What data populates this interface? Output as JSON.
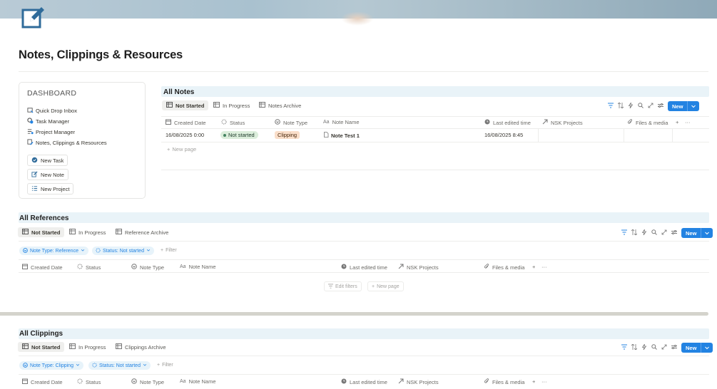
{
  "page": {
    "title": "Notes, Clippings & Resources"
  },
  "dashboard": {
    "title": "DASHBOARD",
    "links": [
      {
        "label": "Quick Drop Inbox",
        "icon": "inbox-icon"
      },
      {
        "label": "Task Manager",
        "icon": "gear-check-icon"
      },
      {
        "label": "Project Manager",
        "icon": "list-icon"
      },
      {
        "label": "Notes, Clippings & Resources",
        "icon": "notes-icon"
      }
    ],
    "buttons": [
      {
        "label": "New Task",
        "icon": "check-circle-icon"
      },
      {
        "label": "New Note",
        "icon": "edit-icon"
      },
      {
        "label": "New Project",
        "icon": "checklist-icon"
      }
    ]
  },
  "all_notes": {
    "title": "All Notes",
    "tabs": [
      "Not Started",
      "In Progress",
      "Notes Archive"
    ],
    "new_label": "New",
    "columns": [
      "Created Date",
      "Status",
      "Note Type",
      "Note Name",
      "Last edited time",
      "NSK Projects",
      "Files & media"
    ],
    "rows": [
      {
        "created": "16/08/2025 0:00",
        "status": "Not started",
        "type": "Clipping",
        "name": "Note Test 1",
        "edited": "16/08/2025 8:45"
      }
    ],
    "new_page": "New page",
    "add_col": "+",
    "more": "···"
  },
  "all_references": {
    "title": "All References",
    "tabs": [
      "Not Started",
      "In Progress",
      "Reference Archive"
    ],
    "new_label": "New",
    "filters": [
      "Note Type: Reference",
      "Status: Not started"
    ],
    "filter_add": "Filter",
    "columns": [
      "Created Date",
      "Status",
      "Note Type",
      "Note Name",
      "Last edited time",
      "NSK Projects",
      "Files & media"
    ],
    "edit_filters": "Edit filters",
    "new_page": "New page",
    "add_col": "+",
    "more": "···"
  },
  "all_clippings": {
    "title": "All Clippings",
    "tabs": [
      "Not Started",
      "In Progress",
      "Clippings Archive"
    ],
    "new_label": "New",
    "filters": [
      "Note Type: Clipping",
      "Status: Not started"
    ],
    "filter_add": "Filter",
    "columns": [
      "Created Date",
      "Status",
      "Note Type",
      "Note Name",
      "Last edited time",
      "NSK Projects",
      "Files & media"
    ],
    "add_col": "+",
    "more": "···"
  },
  "colors": {
    "accent": "#2383e2",
    "header_band": "#e9f3f8",
    "status_green": "#dbeddb",
    "clipping_orange": "#fadec9",
    "page_icon": "#2f6b9a"
  }
}
